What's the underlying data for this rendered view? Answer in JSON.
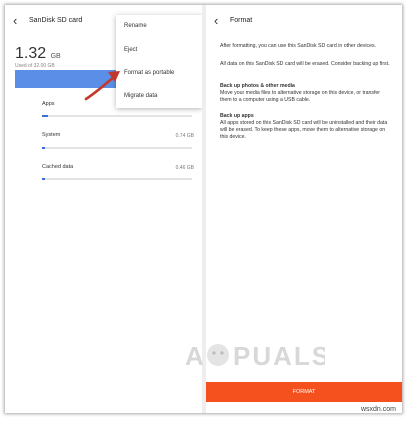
{
  "left": {
    "title": "SanDisk SD card",
    "used_value": "1.32",
    "used_unit": "GB",
    "used_of": "Used of 32.00 GB",
    "rows": [
      {
        "label": "Apps",
        "value": "",
        "fill": 0.04
      },
      {
        "label": "System",
        "value": "0.74 GB",
        "fill": 0.02
      },
      {
        "label": "Cached data",
        "value": "0.46 GB",
        "fill": 0.02
      }
    ]
  },
  "menu": {
    "items": [
      "Rename",
      "Eject",
      "Format as portable",
      "Migrate data"
    ]
  },
  "right": {
    "title": "Format",
    "intro1": "After formatting, you can use this SanDisk SD card in other devices.",
    "intro2": "All data on this SanDisk SD card will be erased. Consider backing up first.",
    "section1_head": "Back up photos & other media",
    "section1_body": "Move your media files to alternative storage on this device, or transfer them to a computer using a USB cable.",
    "section2_head": "Back up apps",
    "section2_body": "All apps stored on this SanDisk SD card will be uninstalled and their data will be erased. To keep these apps, move them to alternative storage on this device.",
    "button_label": "FORMAT"
  },
  "watermark": {
    "text": "A PUALS",
    "site": "wsxdn.com"
  },
  "colors": {
    "accent": "#f4511e",
    "bar": "#5b8ee6",
    "progress": "#3a6fd8",
    "arrow": "#c0392b"
  }
}
